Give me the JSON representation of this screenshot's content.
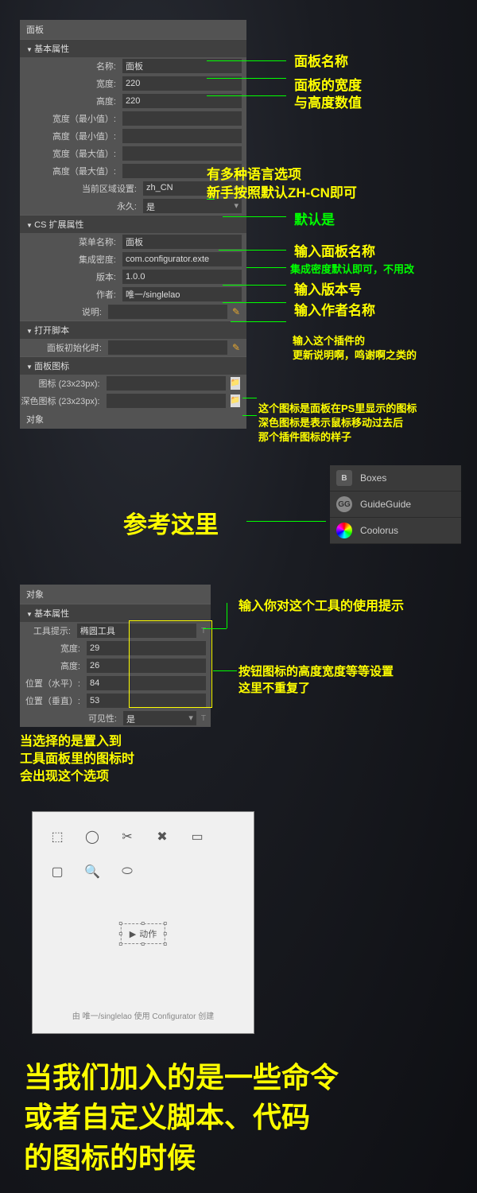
{
  "panel1": {
    "title": "面板",
    "sections": {
      "basic": {
        "header": "基本属性",
        "name_label": "名称:",
        "name_value": "面板",
        "width_label": "宽度:",
        "width_value": "220",
        "height_label": "高度:",
        "height_value": "220",
        "min_width_label": "宽度（最小值）:",
        "min_height_label": "高度（最小值）:",
        "max_width_label": "宽度（最大值）:",
        "max_height_label": "高度（最大值）:",
        "locale_label": "当前区域设置:",
        "locale_value": "zh_CN",
        "permanent_label": "永久:",
        "permanent_value": "是"
      },
      "cs": {
        "header": "CS 扩展属性",
        "menu_label": "菜单名称:",
        "menu_value": "面板",
        "density_label": "集成密度:",
        "density_value": "com.configurator.exte",
        "version_label": "版本:",
        "version_value": "1.0.0",
        "author_label": "作者:",
        "author_value": "唯一/singlelao",
        "desc_label": "说明:",
        "desc_value": ""
      },
      "script": {
        "header": "打开脚本",
        "init_label": "面板初始化时:",
        "init_value": ""
      },
      "icon": {
        "header": "面板图标",
        "icon_label": "图标 (23x23px):",
        "dark_icon_label": "深色图标 (23x23px):"
      },
      "object": "对象"
    }
  },
  "annotations": {
    "a1": "面板名称",
    "a2": "面板的宽度",
    "a3": "与高度数值",
    "a4": "有多种语言选项",
    "a5": "新手按照默认ZH-CN即可",
    "a6": "默认是",
    "a7": "输入面板名称",
    "a8": "集成密度默认即可，不用改",
    "a9": "输入版本号",
    "a10": "输入作者名称",
    "a11": "输入这个插件的",
    "a12": "更新说明啊，鸣谢啊之类的",
    "a13": "这个图标是面板在PS里显示的图标",
    "a14": "深色图标是表示鼠标移动过去后",
    "a15": "那个插件图标的样子",
    "a16": "参考这里",
    "a17": "输入你对这个工具的使用提示",
    "a18": "按钮图标的高度宽度等等设置",
    "a19": "这里不重复了",
    "a20": "当选择的是置入到",
    "a21": "工具面板里的图标时",
    "a22": "会出现这个选项"
  },
  "extensions": {
    "item1": "Boxes",
    "item2": "GuideGuide",
    "item3": "Coolorus"
  },
  "panel2": {
    "title": "对象",
    "section_header": "基本属性",
    "tip_label": "工具提示:",
    "tip_value": "椭圆工具",
    "width_label": "宽度:",
    "width_value": "29",
    "height_label": "高度:",
    "height_value": "26",
    "posx_label": "位置（水平）:",
    "posx_value": "84",
    "posy_label": "位置（垂直）:",
    "posy_value": "53",
    "visible_label": "可见性:",
    "visible_value": "是"
  },
  "preview": {
    "action_label": "动作",
    "footer": "由 唯一/singlelao 使用 Configurator 创建"
  },
  "big_text": {
    "line1": "当我们加入的是一些命令",
    "line2": "或者自定义脚本、代码",
    "line3": "的图标的时候"
  }
}
